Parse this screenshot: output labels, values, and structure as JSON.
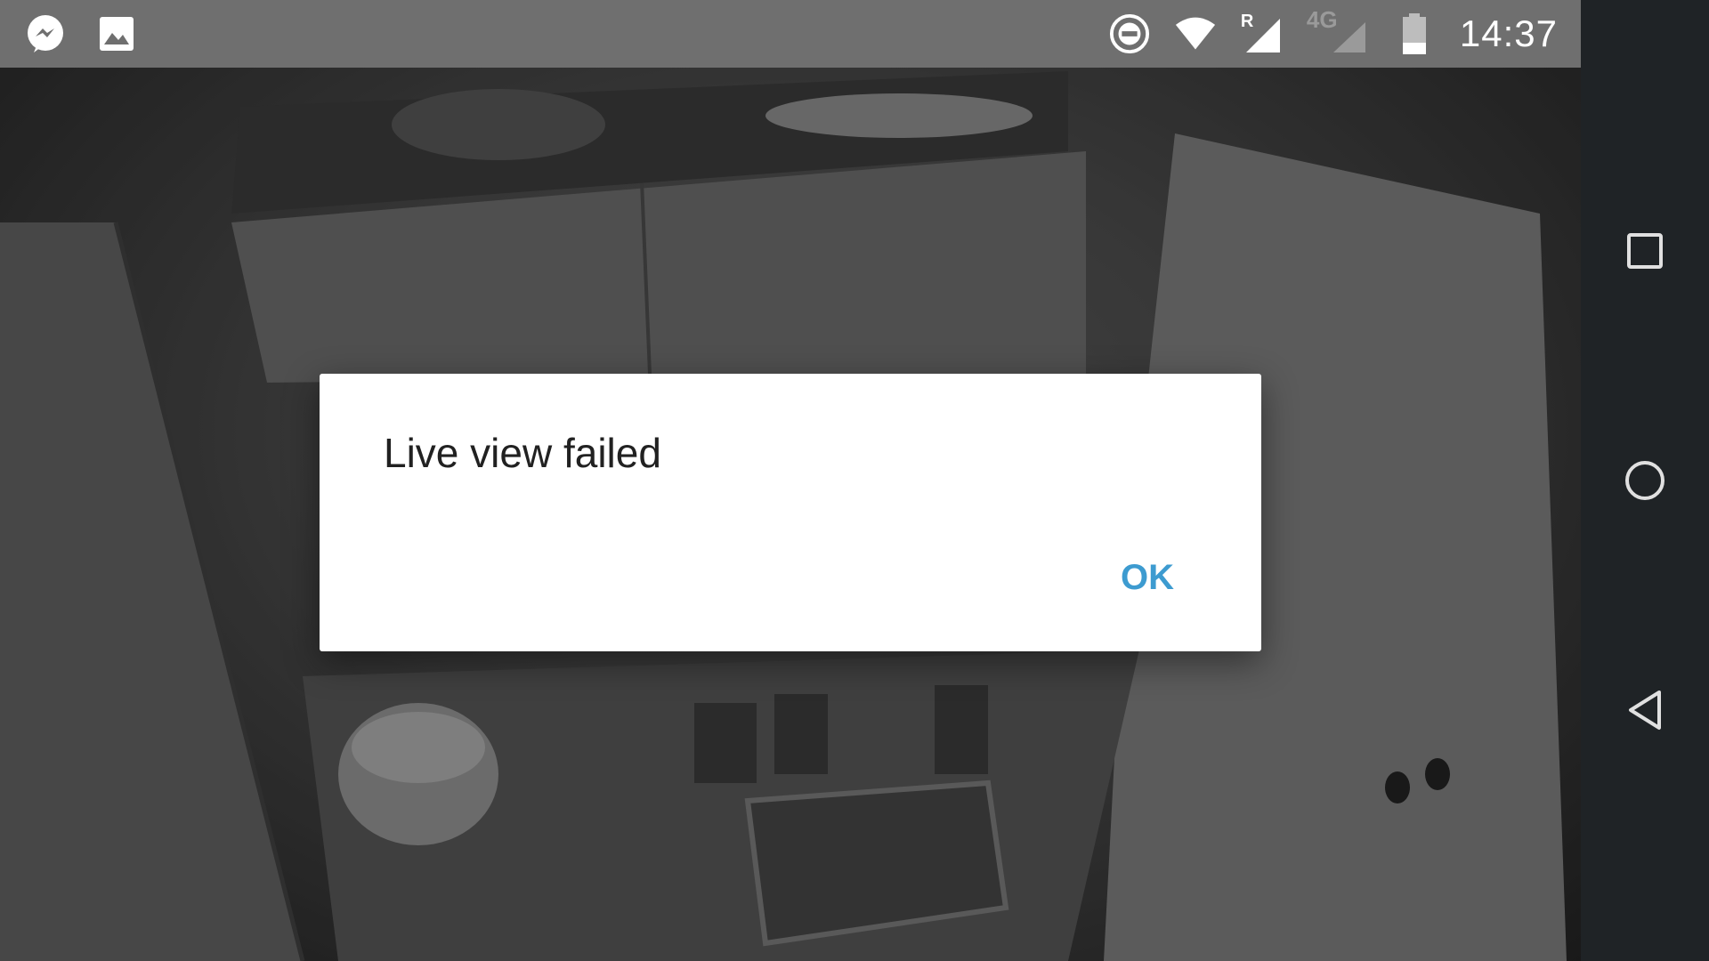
{
  "status_bar": {
    "left_icons": [
      "messenger-icon",
      "gallery-icon"
    ],
    "right_icons": [
      "do-not-disturb-icon",
      "wifi-icon",
      "signal-roaming-icon",
      "signal-4g-icon",
      "battery-icon"
    ],
    "roaming_label": "R",
    "network_label": "4G",
    "time": "14:37"
  },
  "dialog": {
    "title": "Live view failed",
    "ok_label": "OK"
  },
  "navigation": {
    "buttons": [
      "recents-button",
      "home-button",
      "back-button"
    ]
  },
  "colors": {
    "status_bar_bg": "#6f6f6f",
    "nav_bar_bg": "#1f2326",
    "dialog_bg": "#ffffff",
    "dialog_text": "#212121",
    "accent": "#3d9bd0"
  }
}
